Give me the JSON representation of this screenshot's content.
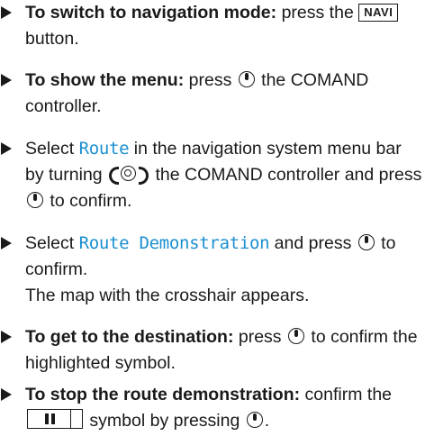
{
  "steps": [
    {
      "lead": "To switch to navigation mode:",
      "t1": " press the",
      "key": "NAVI",
      "t2": " button."
    },
    {
      "lead": "To show the menu:",
      "t1": " press",
      "t2": " the COMAND controller."
    },
    {
      "t1": "Select ",
      "term": "Route",
      "t2": " in the navigation system menu bar by turning",
      "t3": " the COMAND controller and press",
      "t4": " to confirm."
    },
    {
      "t1": "Select ",
      "term": "Route Demonstration",
      "t2": " and press",
      "t3": " to confirm.",
      "note": "The map with the crosshair appears."
    },
    {
      "lead": "To get to the destination:",
      "t1": " press",
      "t2": " to confirm the highlighted symbol."
    },
    {
      "lead": "To stop the route demonstration:",
      "t1": " confirm the",
      "t2": " symbol by pressing",
      "t3": "."
    }
  ],
  "icons": {
    "press": "controller-press-icon",
    "turn": "controller-turn-icon",
    "pause": "pause-symbol-icon",
    "bullet": "triangle-bullet-icon"
  }
}
